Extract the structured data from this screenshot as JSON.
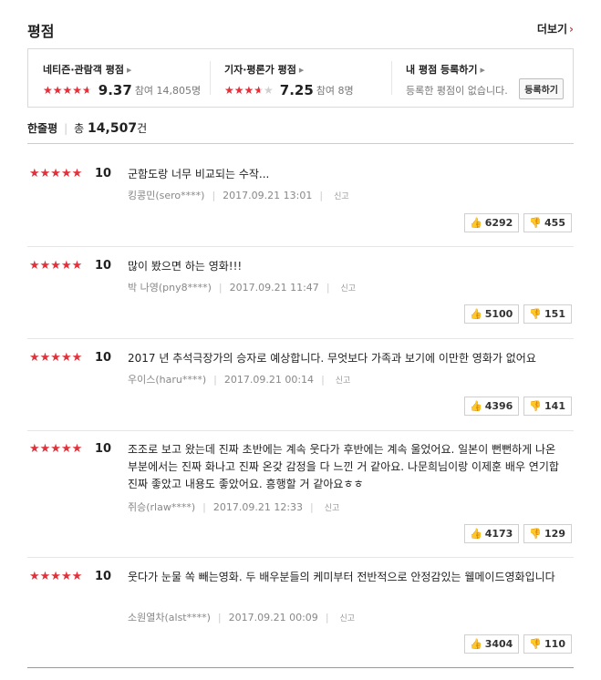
{
  "header": {
    "title": "평점",
    "more_label": "더보기",
    "more_arrow": "›"
  },
  "scores": [
    {
      "title": "네티즌·관람객 평점",
      "score": "9.37",
      "fill_pct": 93.7,
      "count": "참여 14,805명"
    },
    {
      "title": "기자·평론가 평점",
      "score": "7.25",
      "fill_pct": 72.5,
      "count": "참여 8명"
    },
    {
      "title": "내 평점 등록하기",
      "empty_text": "등록한 평점이 없습니다.",
      "button": "등록하기"
    }
  ],
  "summary": {
    "label": "한줄평",
    "total_prefix": "총",
    "total_num": "14,507",
    "total_suffix": "건"
  },
  "stars_glyph": "★★★★★",
  "report_label": "신고",
  "reviews": [
    {
      "score": "10",
      "text": "군함도랑 너무 비교되는 수작...",
      "author": "킹콩민(sero****)",
      "date": "2017.09.21 13:01",
      "up": "6292",
      "down": "455"
    },
    {
      "score": "10",
      "text": "많이 봤으면 하는 영화!!!",
      "author": "박 나영(pny8****)",
      "date": "2017.09.21 11:47",
      "up": "5100",
      "down": "151"
    },
    {
      "score": "10",
      "text": "2017 년 추석극장가의 승자로 예상합니다. 무엇보다 가족과 보기에 이만한 영화가 없어요",
      "author": "우이스(haru****)",
      "date": "2017.09.21 00:14",
      "up": "4396",
      "down": "141"
    },
    {
      "score": "10",
      "text": "조조로 보고 왔는데 진짜 초반에는 계속 웃다가 후반에는 계속 울었어요. 일본이 뻔뻔하게 나온 부분에서는 진짜 화나고 진짜 온갖 감정을 다 느낀 거 같아요. 나문희님이랑 이제훈 배우 연기합 진짜 좋았고 내용도 좋았어요. 흥행할 거 같아요ㅎㅎ",
      "author": "쥐승(rlaw****)",
      "date": "2017.09.21 12:33",
      "up": "4173",
      "down": "129"
    },
    {
      "score": "10",
      "text": "웃다가 눈물 쏙 빼는영화. 두 배우분들의 케미부터 전반적으로 안정감있는 웰메이드영화입니다",
      "author": "소원열차(alst****)",
      "date": "2017.09.21 00:09",
      "up": "3404",
      "down": "110"
    }
  ],
  "colors": {
    "star": "#e2313a",
    "accent": "#e0383e"
  },
  "icons": {
    "thumb_up": "thumb-up-icon",
    "thumb_down": "thumb-down-icon",
    "arrow": "triangle-right-icon"
  }
}
